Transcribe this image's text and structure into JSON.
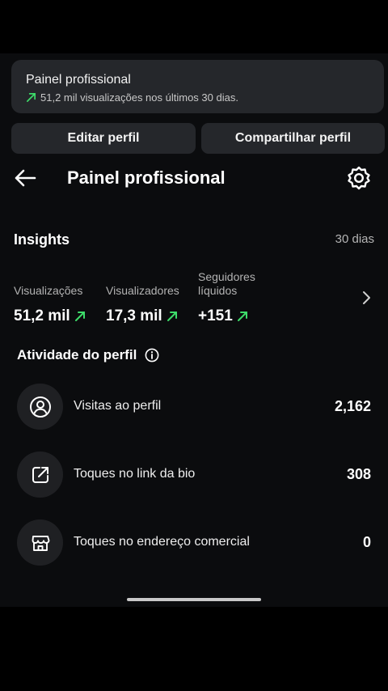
{
  "banner": {
    "title": "Painel profissional",
    "subtitle": "51,2 mil visualizações nos últimos 30 dias."
  },
  "actions": {
    "edit_label": "Editar perfil",
    "share_label": "Compartilhar perfil"
  },
  "header": {
    "title": "Painel profissional"
  },
  "insights": {
    "title": "Insights",
    "period": "30 dias",
    "metrics": [
      {
        "label": "Visualizações",
        "value": "51,2 mil"
      },
      {
        "label": "Visualizadores",
        "value": "17,3 mil"
      },
      {
        "label": "Seguidores líquidos",
        "value": "+151"
      }
    ]
  },
  "activity": {
    "title": "Atividade do perfil",
    "rows": [
      {
        "label": "Visitas ao perfil",
        "value": "2,162",
        "icon": "person-circle-icon"
      },
      {
        "label": "Toques no link da bio",
        "value": "308",
        "icon": "external-link-icon"
      },
      {
        "label": "Toques no endereço comercial",
        "value": "0",
        "icon": "storefront-icon"
      }
    ]
  },
  "colors": {
    "background": "#0b0c0e",
    "card": "#25272b",
    "trend_up": "#3ddc6a"
  }
}
